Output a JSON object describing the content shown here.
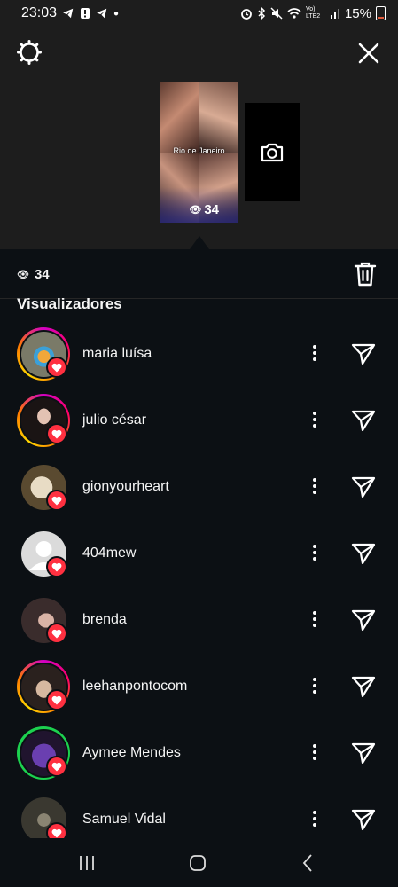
{
  "status_bar": {
    "time": "23:03",
    "battery": "15%",
    "network": "Vo) LTE2",
    "left_icons": [
      "telegram-icon",
      "notification-icon",
      "telegram-icon",
      "dot-icon"
    ],
    "right_icons": [
      "alarm-icon",
      "bluetooth-icon",
      "mute-icon",
      "wifi-icon",
      "signal-icon",
      "battery-icon"
    ]
  },
  "story": {
    "location_sticker": "Rio de Janeiro",
    "views": "34"
  },
  "stats": {
    "views": "34"
  },
  "section_title": "Visualizadores",
  "viewers": [
    {
      "username": "maria luísa",
      "ring": "story",
      "liked": true
    },
    {
      "username": "julio césar",
      "ring": "story",
      "liked": true
    },
    {
      "username": "gionyourheart",
      "ring": "none",
      "liked": true
    },
    {
      "username": "404mew",
      "ring": "none",
      "liked": true
    },
    {
      "username": "brenda",
      "ring": "none",
      "liked": true
    },
    {
      "username": "leehanpontocom",
      "ring": "story",
      "liked": true
    },
    {
      "username": "Aymee Mendes",
      "ring": "close-friends",
      "liked": true
    },
    {
      "username": "Samuel Vidal",
      "ring": "none",
      "liked": true
    }
  ],
  "colors": {
    "background": "#0c1014",
    "header": "#1d1d1d",
    "heart": "#ff3040",
    "close_friends_ring": "#1cd14f"
  }
}
